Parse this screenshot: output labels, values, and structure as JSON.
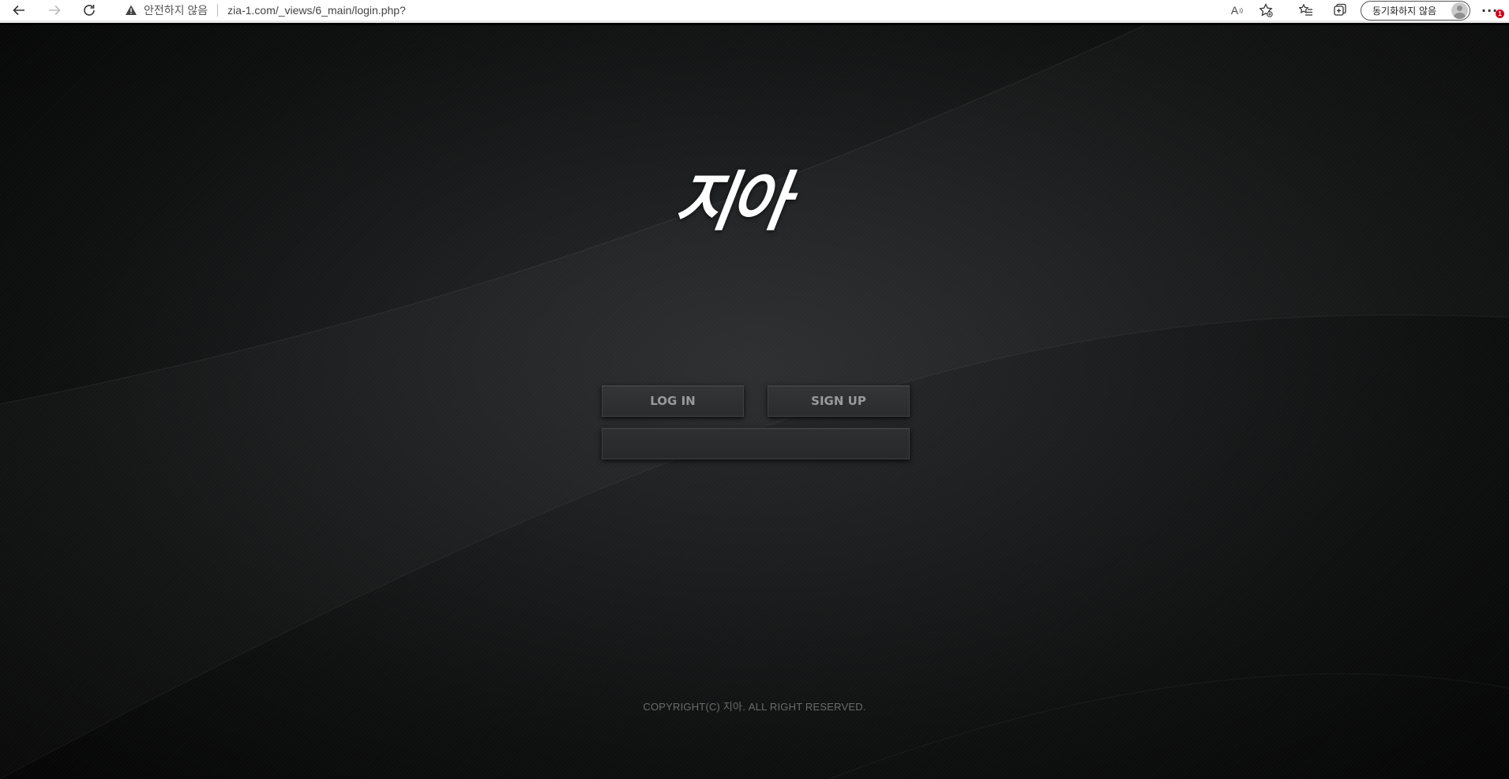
{
  "browser": {
    "security_label": "안전하지 않음",
    "url": "zia-1.com/_views/6_main/login.php?",
    "read_aloud_label": "A",
    "sync_label": "동기화하지 않음",
    "more_label": "···",
    "notification_count": "1"
  },
  "page": {
    "logo_text": "지아",
    "login_label": "LOG IN",
    "signup_label": "SIGN UP",
    "wide_button_label": "",
    "copyright": "COPYRIGHT(C) 지아. ALL RIGHT RESERVED."
  },
  "colors": {
    "background": "#1c1d1e",
    "button_bg": "#2f3032",
    "button_text": "#9a9a9a",
    "logo": "#ffffff",
    "copyright_text": "#6b6b6b",
    "badge": "#d0021b"
  },
  "icons": {
    "back": "arrow-left-icon",
    "forward": "arrow-right-icon",
    "reload": "reload-icon",
    "warning": "warning-triangle-icon",
    "favorite_add": "star-plus-icon",
    "favorites": "favorites-list-icon",
    "collections": "collections-icon",
    "profile": "avatar"
  }
}
